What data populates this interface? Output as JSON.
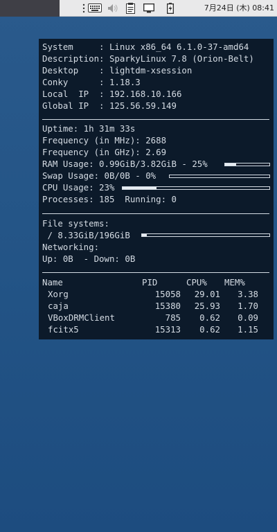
{
  "panel": {
    "clock": "7月24日 (木) 08:41",
    "icons": [
      "keyboard-icon",
      "volume-muted-icon",
      "clipboard-icon",
      "display-icon",
      "battery-charging-icon"
    ]
  },
  "conky": {
    "system": {
      "system": "System     : Linux x86_64 6.1.0-37-amd64",
      "description": "Description: SparkyLinux 7.8 (Orion-Belt)",
      "desktop": "Desktop    : lightdm-xsession",
      "conky": "Conky      : 1.18.3",
      "local_ip": "Local  IP  : 192.168.10.166",
      "global_ip": "Global IP  : 125.56.59.149"
    },
    "stats": {
      "uptime": "Uptime: 1h 31m 33s",
      "freq_mhz": "Frequency (in MHz): 2688",
      "freq_ghz": "Frequency (in GHz): 2.69",
      "ram": "RAM Usage: 0.99GiB/3.82GiB - 25%",
      "ram_percent": 25,
      "swap": "Swap Usage: 0B/0B - 0%",
      "swap_percent": 0,
      "cpu": "CPU Usage: 23%",
      "cpu_percent": 23,
      "processes": "Processes: 185  Running: 0"
    },
    "files": {
      "title": "File systems:",
      "root": " / 8.33GiB/196GiB",
      "root_percent": 4,
      "networking": "Networking:",
      "net": "Up: 0B  - Down: 0B"
    },
    "table": {
      "headers": [
        "Name",
        "PID",
        "CPU%",
        "MEM%"
      ],
      "rows": [
        {
          "name": "Xorg",
          "pid": "15058",
          "cpu": "29.01",
          "mem": "3.38"
        },
        {
          "name": "caja",
          "pid": "15380",
          "cpu": "25.93",
          "mem": "1.70"
        },
        {
          "name": "VBoxDRMClient",
          "pid": "785",
          "cpu": "0.62",
          "mem": "0.09"
        },
        {
          "name": "fcitx5",
          "pid": "15313",
          "cpu": "0.62",
          "mem": "1.15"
        }
      ]
    }
  }
}
